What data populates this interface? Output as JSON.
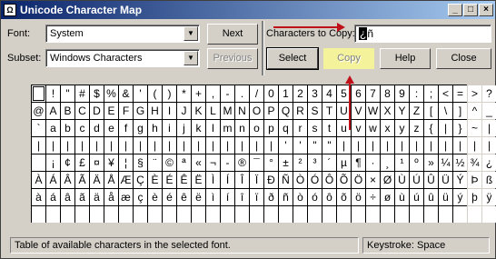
{
  "window": {
    "title": "Unicode Character Map"
  },
  "controls": {
    "font_label": "Font:",
    "font_value": "System",
    "subset_label": "Subset:",
    "subset_value": "Windows Characters",
    "next_label": "Next",
    "previous_label": "Previous",
    "chars_to_copy_label": "Characters to Copy:",
    "chars_to_copy_value": "ñ",
    "chars_to_copy_selected": "¿",
    "select_label": "Select",
    "copy_label": "Copy",
    "help_label": "Help",
    "close_label": "Close"
  },
  "grid": {
    "rows": [
      [
        "",
        "!",
        "\"",
        "#",
        "$",
        "%",
        "&",
        "'",
        "(",
        ")",
        "*",
        "+",
        ",",
        "-",
        ".",
        "/",
        "0",
        "1",
        "2",
        "3",
        "4",
        "5",
        "6",
        "7",
        "8",
        "9",
        ":",
        ";",
        "<",
        "=",
        ">",
        "?"
      ],
      [
        "@",
        "A",
        "B",
        "C",
        "D",
        "E",
        "F",
        "G",
        "H",
        "I",
        "J",
        "K",
        "L",
        "M",
        "N",
        "O",
        "P",
        "Q",
        "R",
        "S",
        "T",
        "U",
        "V",
        "W",
        "X",
        "Y",
        "Z",
        "[",
        "\\",
        "]",
        "^",
        "_"
      ],
      [
        "`",
        "a",
        "b",
        "c",
        "d",
        "e",
        "f",
        "g",
        "h",
        "i",
        "j",
        "k",
        "l",
        "m",
        "n",
        "o",
        "p",
        "q",
        "r",
        "s",
        "t",
        "u",
        "v",
        "w",
        "x",
        "y",
        "z",
        "{",
        "|",
        "}",
        "~",
        "|"
      ],
      [
        "|",
        "|",
        "|",
        "|",
        "|",
        "|",
        "|",
        "|",
        "|",
        "|",
        "|",
        "|",
        "|",
        "|",
        "|",
        "|",
        "|",
        "'",
        "'",
        "\"",
        "\"",
        "|",
        "|",
        "|",
        "|",
        "|",
        "|",
        "|",
        "|",
        "|",
        "|",
        "|"
      ],
      [
        "",
        "¡",
        "¢",
        "£",
        "¤",
        "¥",
        "¦",
        "§",
        "¨",
        "©",
        "ª",
        "«",
        "¬",
        "-",
        "®",
        "¯",
        "°",
        "±",
        "²",
        "³",
        "´",
        "µ",
        "¶",
        "·",
        "¸",
        "¹",
        "º",
        "»",
        "¼",
        "½",
        "¾",
        "¿"
      ],
      [
        "À",
        "Á",
        "Â",
        "Ã",
        "Ä",
        "Å",
        "Æ",
        "Ç",
        "È",
        "É",
        "Ê",
        "Ë",
        "Ì",
        "Í",
        "Î",
        "Ï",
        "Ð",
        "Ñ",
        "Ò",
        "Ó",
        "Ô",
        "Õ",
        "Ö",
        "×",
        "Ø",
        "Ù",
        "Ú",
        "Û",
        "Ü",
        "Ý",
        "Þ",
        "ß"
      ],
      [
        "à",
        "á",
        "â",
        "ã",
        "ä",
        "å",
        "æ",
        "ç",
        "è",
        "é",
        "ê",
        "ë",
        "ì",
        "í",
        "î",
        "ï",
        "ð",
        "ñ",
        "ò",
        "ó",
        "ô",
        "õ",
        "ö",
        "÷",
        "ø",
        "ù",
        "ú",
        "û",
        "ü",
        "ý",
        "þ",
        "ÿ"
      ],
      [
        "",
        "",
        "",
        "",
        "",
        "",
        "",
        "",
        "",
        "",
        "",
        "",
        "",
        "",
        "",
        "",
        "",
        "",
        "",
        "",
        "",
        "",
        "",
        "",
        "",
        "",
        "",
        "",
        "",
        "",
        "",
        ""
      ]
    ]
  },
  "status": {
    "text": "Table of available characters in the selected font.",
    "keystroke": "Keystroke: Space"
  },
  "colors": {
    "annotation_arrow": "#c0101a",
    "copy_highlight": "#f4f29a"
  }
}
